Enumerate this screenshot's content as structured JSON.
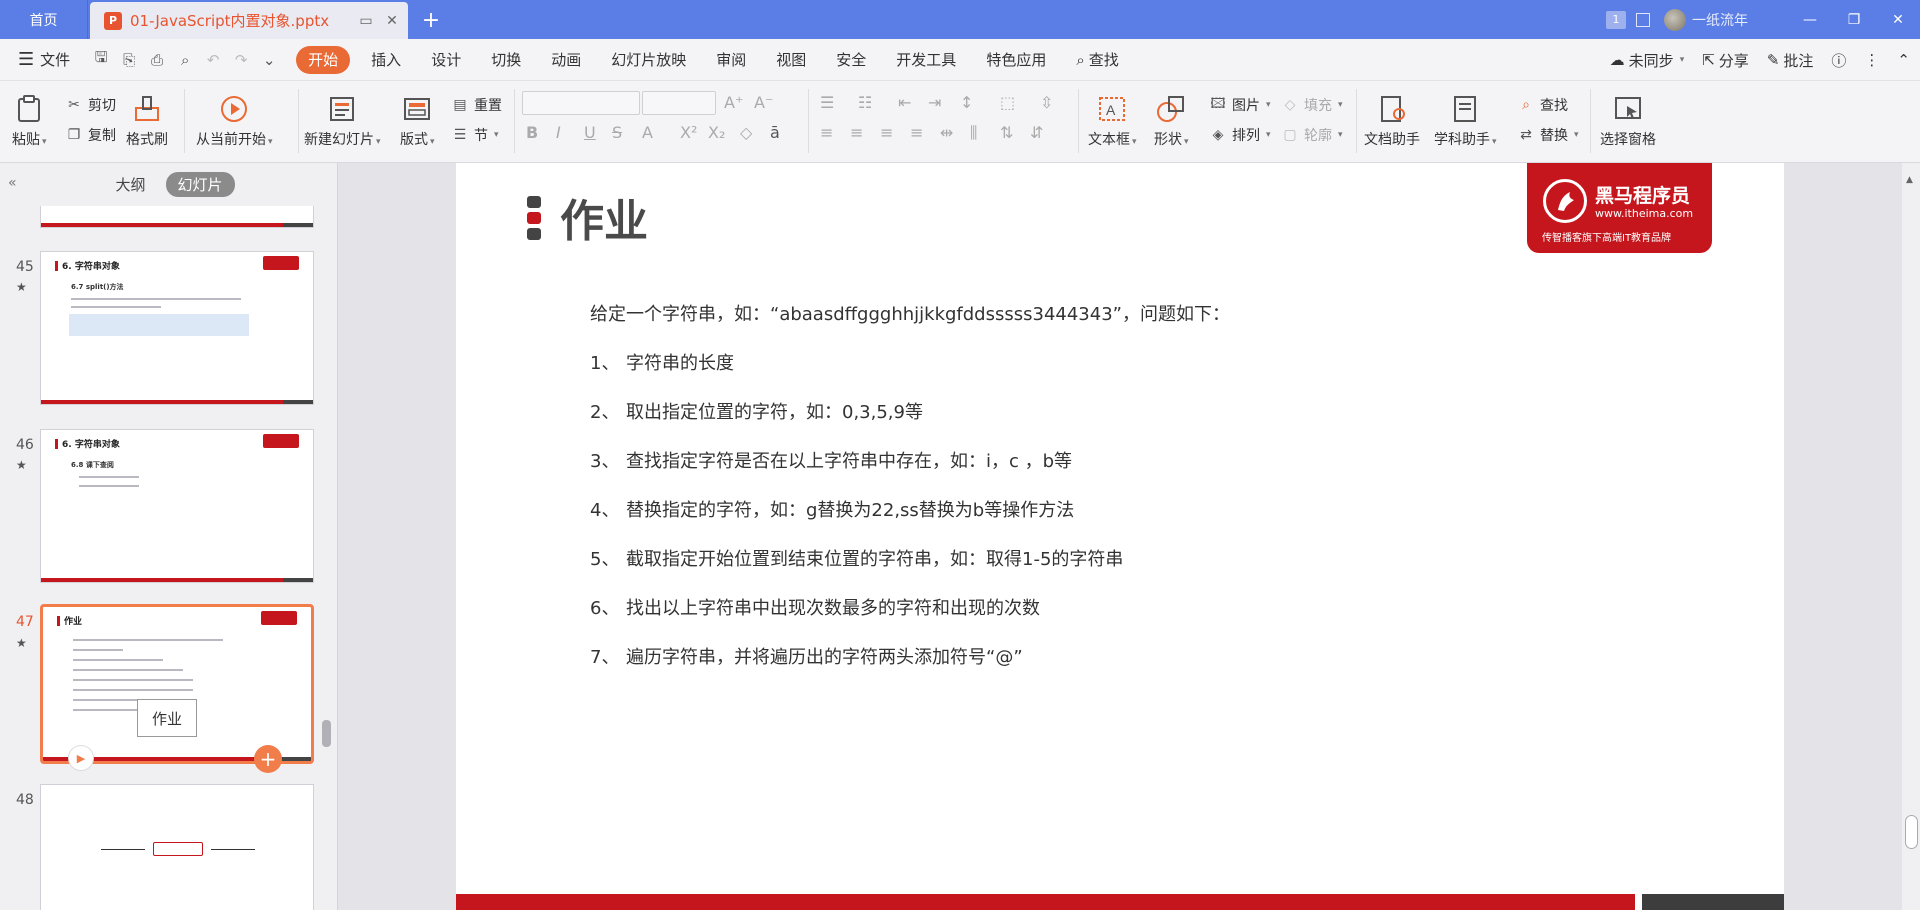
{
  "titlebar": {
    "home_tab": "首页",
    "doc_tab": "01-JavaScript内置对象.pptx",
    "ppt_badge": "P",
    "page_badge": "1",
    "user_name": "一纸流年"
  },
  "menubar": {
    "file": "文件",
    "items": [
      "开始",
      "插入",
      "设计",
      "切换",
      "动画",
      "幻灯片放映",
      "审阅",
      "视图",
      "安全",
      "开发工具",
      "特色应用"
    ],
    "search": "查找",
    "sync": "未同步",
    "share": "分享",
    "comment": "批注"
  },
  "ribbon": {
    "paste": "粘贴",
    "cut": "剪切",
    "copy": "复制",
    "format_painter": "格式刷",
    "from_current": "从当前开始",
    "new_slide": "新建幻灯片",
    "layout": "版式",
    "reset": "重置",
    "section": "节",
    "textbox": "文本框",
    "shape": "形状",
    "picture": "图片",
    "fill": "填充",
    "arrange": "排列",
    "outline": "轮廓",
    "doc_assistant": "文档助手",
    "subject_assistant": "学科助手",
    "find": "查找",
    "replace": "替换",
    "selection_pane": "选择窗格"
  },
  "panel": {
    "tab_outline": "大纲",
    "tab_slides": "幻灯片",
    "slides": [
      {
        "num": "45",
        "title": "6. 字符串对象",
        "subtitle": "6.7 split()方法"
      },
      {
        "num": "46",
        "title": "6. 字符串对象",
        "subtitle": "6.8 课下查阅"
      },
      {
        "num": "47",
        "title": "作业",
        "tooltip": "作业"
      },
      {
        "num": "48"
      }
    ]
  },
  "slide": {
    "title": "作业",
    "logo_name": "黑马程序员",
    "logo_url": "www.itheima.com",
    "logo_slogan": "传智播客旗下高端IT教育品牌",
    "intro": "给定一个字符串，如：“abaasdffggghhjjkkgfddsssss3444343”，问题如下：",
    "items": [
      {
        "n": "1、",
        "text": "字符串的长度"
      },
      {
        "n": "2、",
        "text": "取出指定位置的字符，如：0,3,5,9等"
      },
      {
        "n": "3、",
        "text": "查找指定字符是否在以上字符串中存在，如：i，c ，b等"
      },
      {
        "n": "4、",
        "text": "替换指定的字符，如：g替换为22,ss替换为b等操作方法"
      },
      {
        "n": "5、",
        "text": "截取指定开始位置到结束位置的字符串，如：取得1-5的字符串"
      },
      {
        "n": "6、",
        "text": "找出以上字符串中出现次数最多的字符和出现的次数"
      },
      {
        "n": "7、",
        "text": "遍历字符串，并将遍历出的字符两头添加符号“@”"
      }
    ]
  },
  "colors": {
    "titlebar": "#5a7de6",
    "accent": "#e96a34",
    "brand_red": "#c4161c"
  }
}
